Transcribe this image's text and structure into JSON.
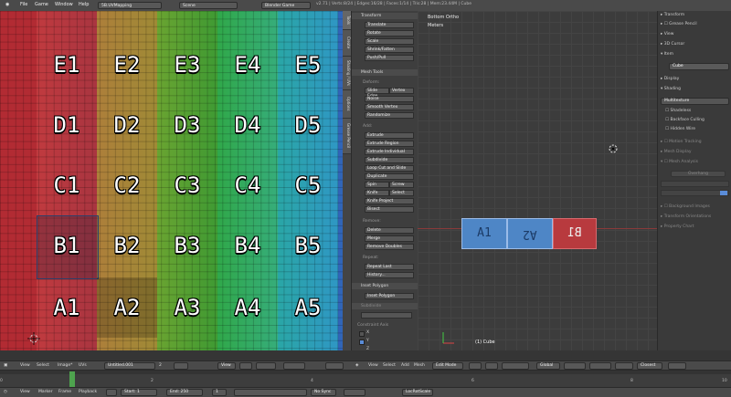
{
  "topbar": {
    "menu": [
      "File",
      "Game",
      "Window",
      "Help"
    ],
    "layout": "5B.UVMapping",
    "scene": "Scene",
    "engine": "Blender Game",
    "stats": "v2.71 | Verts:8/24 | Edges:16/28 | Faces:1/14 | Tris:28 | Mem:23.44M | Cube"
  },
  "uv_grid": {
    "rows": [
      "E",
      "D",
      "C",
      "B",
      "A"
    ],
    "cols": [
      "1",
      "2",
      "3",
      "4",
      "5"
    ]
  },
  "tool_tabs": [
    "Tools",
    "Create",
    "Shading / UVs",
    "Options",
    "Grease Pencil"
  ],
  "toolshelf": {
    "transform_header": "Transform",
    "transform": [
      "Translate",
      "Rotate",
      "Scale",
      "Shrink/Fatten",
      "Push/Pull"
    ],
    "mesh_tools_header": "Mesh Tools",
    "deform_label": "Deform:",
    "slide_edge": "Slide Edge",
    "vertex": "Vertex",
    "noise": "Noise",
    "smooth_vertex": "Smooth Vertex",
    "randomize": "Randomize",
    "add_label": "Add:",
    "add": [
      "Extrude",
      "Extrude Region",
      "Extrude Individual",
      "Subdivide",
      "Loop Cut and Slide",
      "Duplicate"
    ],
    "spin": "Spin",
    "screw": "Screw",
    "knife": "Knife",
    "select": "Select",
    "knife_project": "Knife Project",
    "bisect": "Bisect",
    "remove_label": "Remove:",
    "delete": "Delete",
    "merge": "Merge",
    "remove_doubles": "Remove Doubles",
    "repeat_label": "Repeat:",
    "repeat_last": "Repeat Last",
    "history": "History...",
    "inset_polygon_header": "Inset Polygon",
    "inset_polygon": "Inset Polygon",
    "subdivide_header": "Subdivide",
    "axis_label": "Constraint Axis",
    "axis_x": "X",
    "axis_y": "Y",
    "axis_z": "Z"
  },
  "viewport": {
    "view_name": "Bottom Ortho",
    "units": "Meters",
    "object_label": "(1) Cube",
    "faces": [
      "A1",
      "A2",
      "B1"
    ]
  },
  "props": {
    "transform": "Transform",
    "grease_pencil": "Grease Pencil",
    "view": "View",
    "cursor": "3D Cursor",
    "item": "Item",
    "item_name": "Cube",
    "display": "Display",
    "shading": "Shading",
    "shading_mode": "Multitexture",
    "shadeless": "Shadeless",
    "backface": "Backface Culling",
    "hidden_wire": "Hidden Wire",
    "motion_tracking": "Motion Tracking",
    "mesh_display": "Mesh Display",
    "mesh_analysis": "Mesh Analysis",
    "overhang": "Overhang",
    "bg_images": "Background Images",
    "transform_orient": "Transform Orientations",
    "property_chart": "Property Chart"
  },
  "uv_header": {
    "items": [
      "View",
      "Select",
      "Image*",
      "UVs"
    ],
    "image_name": "Untitled.001",
    "users": "2",
    "view_select": "View"
  },
  "v3d_header": {
    "view": "View",
    "select": "Select",
    "add": "Add",
    "mesh": "Mesh",
    "mode": "Edit Mode",
    "orientation": "Global",
    "snap": "Closest"
  },
  "timeline": {
    "ticks": [
      "0",
      "2",
      "4",
      "6",
      "8",
      "10"
    ]
  },
  "timeline_header": {
    "items": [
      "View",
      "Marker",
      "Frame",
      "Playback"
    ],
    "start": "Start:",
    "start_val": "1",
    "end": "End:",
    "end_val": "250",
    "frame": "1",
    "sync": "No Sync",
    "keying": "LocRotScale"
  },
  "colors": {
    "col1": "#c0353b",
    "col2": "#b8993a",
    "col3": "#4fa83a",
    "col4": "#3bb358",
    "col5": "#2fb4b8",
    "selected_face": "#4a7fc0",
    "red_face": "#c03a3a"
  }
}
